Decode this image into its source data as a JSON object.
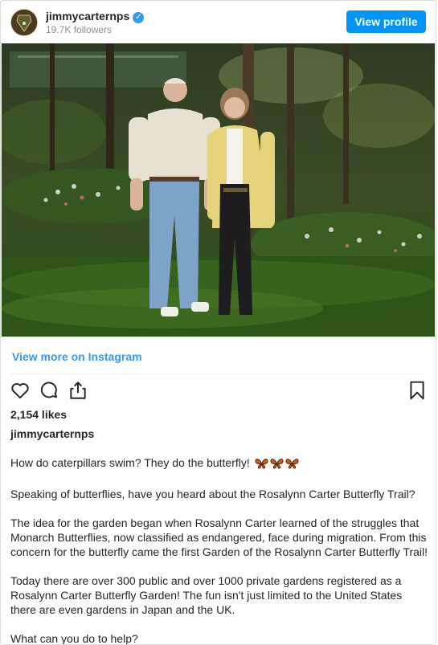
{
  "header": {
    "username": "jimmycarternps",
    "followers": "19.7K followers",
    "view_profile_label": "View profile"
  },
  "post": {
    "view_more_label": "View more on Instagram",
    "likes": "2,154 likes",
    "author": "jimmycarternps",
    "caption": {
      "p1": "How do caterpillars swim? They do the butterfly!",
      "p2": "Speaking of butterflies, have you heard about the Rosalynn Carter Butterfly Trail?",
      "p3": "The idea for the garden began when Rosalynn Carter learned of the struggles that Monarch Butterflies, now classified as endangered, face during migration. From this concern for the butterfly came the first Garden of the Rosalynn Carter Butterfly Trail!",
      "p4": "Today there are over 300 public and over 1000 private gardens registered as a Rosalynn Carter Butterfly Garden! The fun isn't just limited to the United States there are even gardens in Japan and the UK.",
      "p5": "What can you do to help?"
    }
  },
  "icons": {
    "like": "heart-icon",
    "comment": "comment-icon",
    "share": "share-icon",
    "save": "bookmark-icon",
    "verified": "verified-badge-icon",
    "butterfly": "butterfly-emoji-icon"
  },
  "colors": {
    "link": "#3897f0",
    "button": "#0095f6",
    "text": "#262626",
    "muted": "#8e8e8e"
  }
}
